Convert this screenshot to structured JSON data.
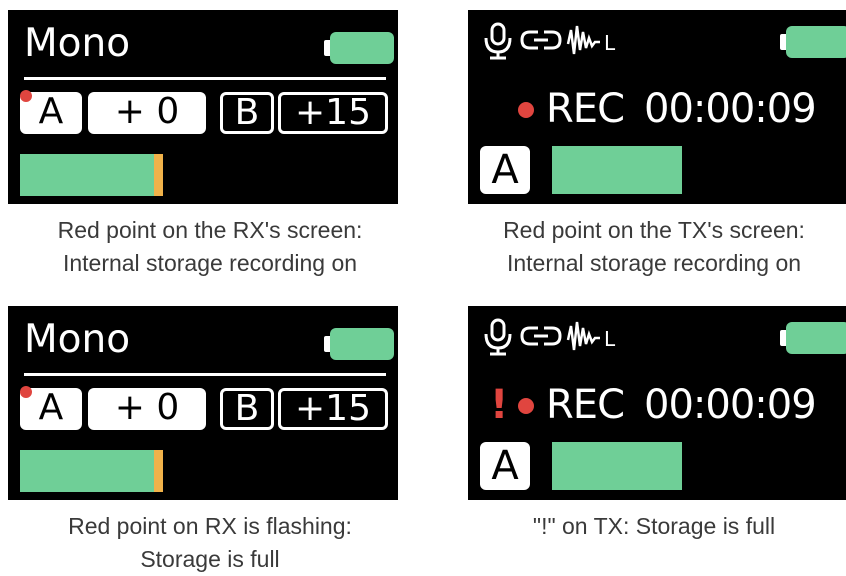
{
  "colors": {
    "screen_bg": "#000000",
    "battery": "#6fcf97",
    "meter": "#6fcf97",
    "meter_peak": "#f1b24a",
    "indicator_red": "#e0453f",
    "caption_text": "#3a3a3a"
  },
  "panels": [
    {
      "device": "RX",
      "mode": "Mono",
      "channel_a": "A",
      "gain_a": "+ 0",
      "channel_b": "B",
      "gain_b": "+15",
      "caption": [
        "Red point on the RX's screen:",
        "Internal storage recording on"
      ]
    },
    {
      "device": "TX",
      "icons": [
        "microphone-icon",
        "link-icon",
        "waveform-icon"
      ],
      "icon_suffix": "L",
      "rec_label": "REC",
      "rec_time": "00:00:09",
      "channel": "A",
      "caption": [
        "Red point on the TX's screen:",
        "Internal storage recording on"
      ]
    },
    {
      "device": "RX",
      "mode": "Mono",
      "channel_a": "A",
      "gain_a": "+ 0",
      "channel_b": "B",
      "gain_b": "+15",
      "caption": [
        "Red point on RX is flashing:",
        "Storage is full"
      ]
    },
    {
      "device": "TX",
      "icons": [
        "microphone-icon",
        "link-icon",
        "waveform-icon"
      ],
      "icon_suffix": "L",
      "warning": "!",
      "rec_label": "REC",
      "rec_time": "00:00:09",
      "channel": "A",
      "caption": [
        "\"!\" on TX: Storage is full"
      ]
    }
  ]
}
